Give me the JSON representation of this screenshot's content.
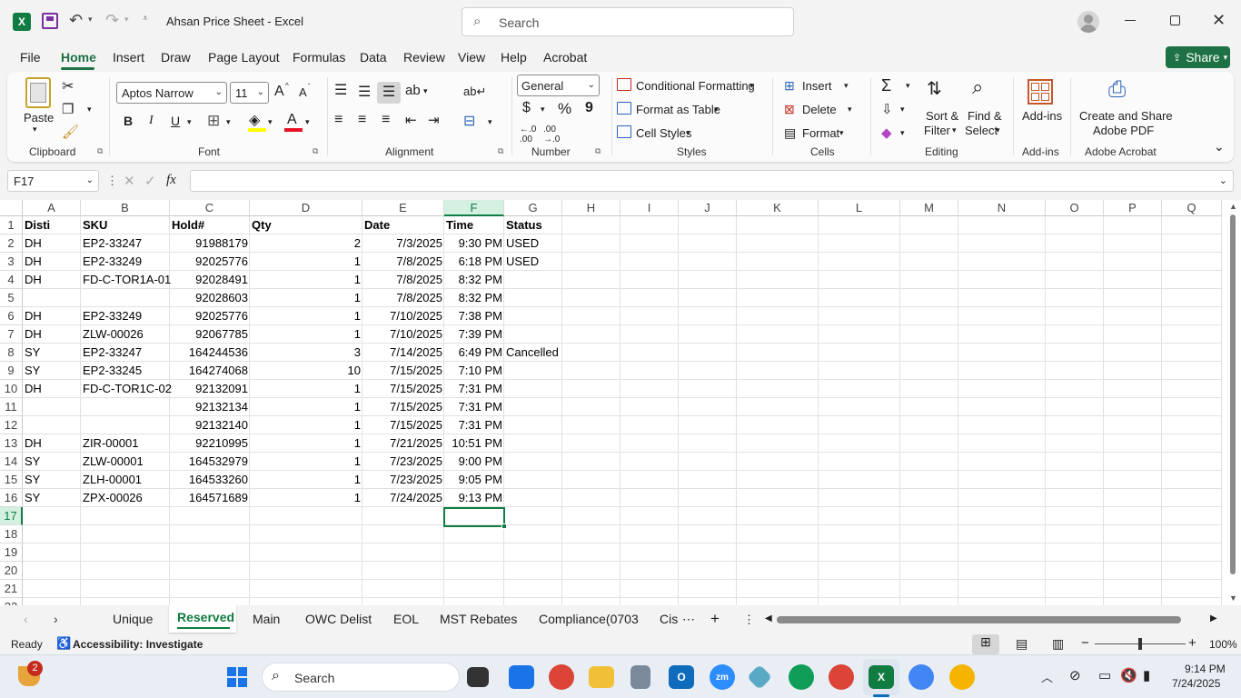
{
  "window": {
    "title": "Ahsan Price Sheet  -  Excel",
    "search_placeholder": "Search"
  },
  "menu": {
    "items": [
      "File",
      "Home",
      "Insert",
      "Draw",
      "Page Layout",
      "Formulas",
      "Data",
      "Review",
      "View",
      "Help",
      "Acrobat"
    ],
    "active": "Home",
    "share": "Share"
  },
  "ribbon": {
    "clipboard": {
      "paste": "Paste",
      "label": "Clipboard"
    },
    "font": {
      "name": "Aptos Narrow",
      "size": "11",
      "label": "Font",
      "bold": "B",
      "italic": "I",
      "underline": "U",
      "grow": "A",
      "shrink": "A",
      "color_letter": "A"
    },
    "alignment": {
      "label": "Alignment"
    },
    "number": {
      "format": "General",
      "label": "Number",
      "currency": "$",
      "percent": "%",
      "comma": "9"
    },
    "styles": {
      "conditional": "Conditional Formatting",
      "table": "Format as Table",
      "cell": "Cell Styles",
      "label": "Styles"
    },
    "cells": {
      "insert": "Insert",
      "delete": "Delete",
      "format": "Format",
      "label": "Cells"
    },
    "editing": {
      "sort1": "Sort &",
      "sort2": "Filter",
      "find1": "Find &",
      "find2": "Select",
      "label": "Editing"
    },
    "addins": {
      "btn": "Add-ins",
      "label": "Add-ins"
    },
    "acrobat": {
      "btn1": "Create and Share",
      "btn2": "Adobe PDF",
      "label": "Adobe Acrobat"
    }
  },
  "formula": {
    "namebox": "F17",
    "fx": "fx",
    "content": ""
  },
  "columns": [
    "A",
    "B",
    "C",
    "D",
    "E",
    "F",
    "G",
    "H",
    "I",
    "J",
    "K",
    "L",
    "M",
    "N",
    "O",
    "P",
    "Q"
  ],
  "rows": [
    {
      "n": "1",
      "A": "Disti",
      "B": "SKU",
      "C": "Hold#",
      "D": "Qty",
      "E": "Date",
      "F": "Time",
      "G": "Status"
    },
    {
      "n": "2",
      "A": "DH",
      "B": "EP2-33247",
      "C": "91988179",
      "D": "2",
      "E": "7/3/2025",
      "F": "9:30 PM",
      "G": "USED"
    },
    {
      "n": "3",
      "A": "DH",
      "B": "EP2-33249",
      "C": "92025776",
      "D": "1",
      "E": "7/8/2025",
      "F": "6:18 PM",
      "G": "USED"
    },
    {
      "n": "4",
      "A": "DH",
      "B": "FD-C-TOR1A-01",
      "C": "92028491",
      "D": "1",
      "E": "7/8/2025",
      "F": "8:32 PM",
      "G": ""
    },
    {
      "n": "5",
      "A": "",
      "B": "",
      "C": "92028603",
      "D": "1",
      "E": "7/8/2025",
      "F": "8:32 PM",
      "G": ""
    },
    {
      "n": "6",
      "A": "DH",
      "B": "EP2-33249",
      "C": "92025776",
      "D": "1",
      "E": "7/10/2025",
      "F": "7:38 PM",
      "G": ""
    },
    {
      "n": "7",
      "A": "DH",
      "B": "ZLW-00026",
      "C": "92067785",
      "D": "1",
      "E": "7/10/2025",
      "F": "7:39 PM",
      "G": ""
    },
    {
      "n": "8",
      "A": "SY",
      "B": "EP2-33247",
      "C": "164244536",
      "D": "3",
      "E": "7/14/2025",
      "F": "6:49 PM",
      "G": "Cancelled"
    },
    {
      "n": "9",
      "A": "SY",
      "B": "EP2-33245",
      "C": "164274068",
      "D": "10",
      "E": "7/15/2025",
      "F": "7:10 PM",
      "G": ""
    },
    {
      "n": "10",
      "A": "DH",
      "B": "FD-C-TOR1C-02",
      "C": "92132091",
      "D": "1",
      "E": "7/15/2025",
      "F": "7:31 PM",
      "G": ""
    },
    {
      "n": "11",
      "A": "",
      "B": "",
      "C": "92132134",
      "D": "1",
      "E": "7/15/2025",
      "F": "7:31 PM",
      "G": ""
    },
    {
      "n": "12",
      "A": "",
      "B": "",
      "C": "92132140",
      "D": "1",
      "E": "7/15/2025",
      "F": "7:31 PM",
      "G": ""
    },
    {
      "n": "13",
      "A": "DH",
      "B": "ZIR-00001",
      "C": "92210995",
      "D": "1",
      "E": "7/21/2025",
      "F": "10:51 PM",
      "G": ""
    },
    {
      "n": "14",
      "A": "SY",
      "B": "ZLW-00001",
      "C": "164532979",
      "D": "1",
      "E": "7/23/2025",
      "F": "9:00 PM",
      "G": ""
    },
    {
      "n": "15",
      "A": "SY",
      "B": "ZLH-00001",
      "C": "164533260",
      "D": "1",
      "E": "7/23/2025",
      "F": "9:05 PM",
      "G": ""
    },
    {
      "n": "16",
      "A": "SY",
      "B": "ZPX-00026",
      "C": "164571689",
      "D": "1",
      "E": "7/24/2025",
      "F": "9:13 PM",
      "G": ""
    },
    {
      "n": "17"
    },
    {
      "n": "18"
    },
    {
      "n": "19"
    },
    {
      "n": "20"
    },
    {
      "n": "21"
    },
    {
      "n": "22"
    }
  ],
  "sheets": {
    "tabs": [
      "Unique",
      "Reserved",
      "Main",
      "OWC Delist",
      "EOL",
      "MST Rebates",
      "Compliance(0703",
      "Cis"
    ],
    "active": "Reserved"
  },
  "status": {
    "ready": "Ready",
    "accessibility": "Accessibility: Investigate",
    "zoom": "100%"
  },
  "taskbar": {
    "search": "Search",
    "time": "9:14 PM",
    "date": "7/24/2025",
    "badge": "2"
  },
  "colors": {
    "excel_green": "#107c41",
    "share_green": "#1e7145",
    "accent": "#1e7145"
  }
}
